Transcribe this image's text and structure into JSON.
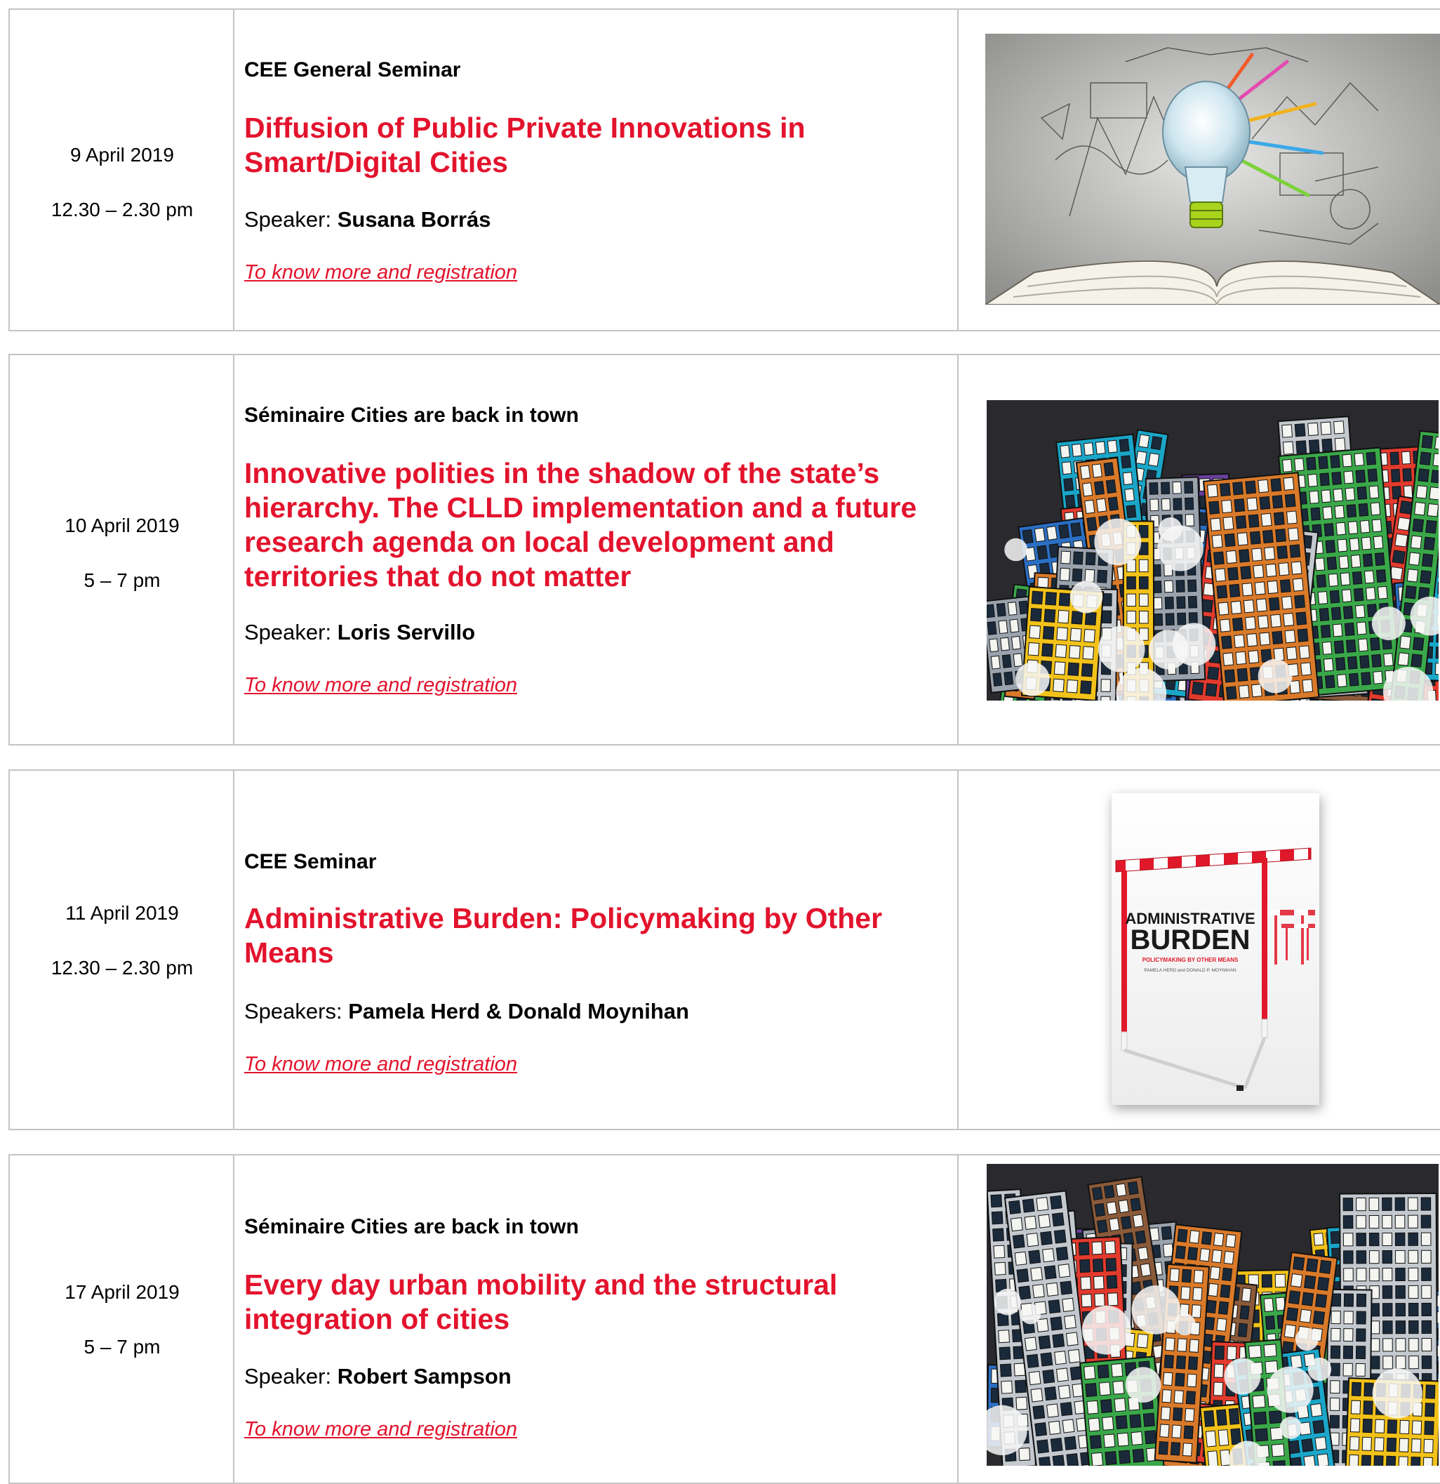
{
  "events": [
    {
      "date": "9 April 2019",
      "time": "12.30 – 2.30 pm",
      "series": "CEE General Seminar",
      "title_lines": [
        "Diffusion of Public Private Innovations in",
        "Smart/Digital Cities"
      ],
      "speaker_prefix": "Speaker: ",
      "speaker_name": "Susana Borrás",
      "link": "To know more and registration",
      "image_icon": "lightbulb-sketch-book-image"
    },
    {
      "date": "10 April 2019",
      "time": "5 – 7 pm",
      "series": "Séminaire Cities are back in town",
      "title_lines": [
        "Innovative polities in the shadow of the state’s",
        "hierarchy. The CLLD implementation and a future",
        "research agenda on local development and",
        "territories that do not matter"
      ],
      "speaker_prefix": "Speaker: ",
      "speaker_name": "Loris Servillo",
      "link": "To know more and registration",
      "image_icon": "city-graffiti-image"
    },
    {
      "date": "11 April 2019",
      "time": "12.30 – 2.30 pm",
      "series": "CEE Seminar",
      "title_lines": [
        "Administrative Burden: Policymaking by Other",
        "Means"
      ],
      "speaker_prefix": "Speakers: ",
      "speaker_name": "Pamela Herd & Donald Moynihan",
      "link": "To know more and registration",
      "image_icon": "book-cover-image",
      "book": {
        "title_small": "ADMINISTRATIVE",
        "title_big": "BURDEN",
        "subtitle": "POLICYMAKING BY OTHER MEANS",
        "authors": "PAMELA HERD and DONALD P. MOYNIHAN"
      }
    },
    {
      "date": "17 April 2019",
      "time": "5 – 7 pm",
      "series": "Séminaire Cities are back in town",
      "title_lines": [
        "Every day urban mobility and the structural",
        "integration of cities"
      ],
      "speaker_prefix": "Speaker: ",
      "speaker_name": "Robert Sampson",
      "link": "To know more and registration",
      "image_icon": "city-graffiti-image"
    }
  ],
  "colors": {
    "accent": "#e3132d",
    "border": "#c4c4c4"
  }
}
